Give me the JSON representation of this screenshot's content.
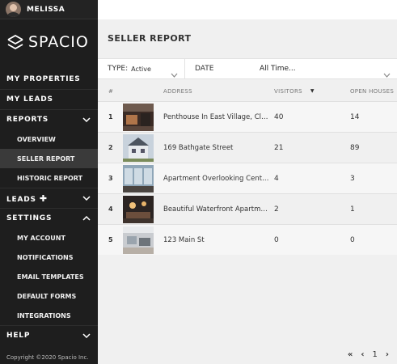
{
  "user": {
    "name": "MELISSA"
  },
  "brand": {
    "name": "SPACIO"
  },
  "nav": {
    "my_properties": "MY PROPERTIES",
    "my_leads": "MY LEADS",
    "reports": "REPORTS",
    "reports_items": [
      "OVERVIEW",
      "SELLER REPORT",
      "HISTORIC REPORT"
    ],
    "leads": "LEADS",
    "settings": "SETTINGS",
    "settings_items": [
      "MY ACCOUNT",
      "NOTIFICATIONS",
      "EMAIL TEMPLATES",
      "DEFAULT FORMS",
      "INTEGRATIONS"
    ],
    "help": "HELP",
    "copyright": "Copyright ©2020 Spacio Inc."
  },
  "page": {
    "title": "SELLER REPORT"
  },
  "filters": {
    "type_label": "TYPE:",
    "type_value": "Active",
    "date_label": "DATE",
    "date_value": "All Time..."
  },
  "table": {
    "headers": {
      "num": "#",
      "address": "ADDRESS",
      "visitors": "VISITORS",
      "open_houses": "OPEN HOUSES"
    },
    "rows": [
      {
        "num": "1",
        "address": "Penthouse In East Village, Clo...",
        "visitors": "40",
        "open_houses": "14"
      },
      {
        "num": "2",
        "address": "169 Bathgate Street",
        "visitors": "21",
        "open_houses": "89"
      },
      {
        "num": "3",
        "address": "Apartment Overlooking Centr...",
        "visitors": "4",
        "open_houses": "3"
      },
      {
        "num": "4",
        "address": "Beautiful Waterfront Apartme...",
        "visitors": "2",
        "open_houses": "1"
      },
      {
        "num": "5",
        "address": "123 Main St",
        "visitors": "0",
        "open_houses": "0"
      }
    ]
  },
  "pagination": {
    "first": "«",
    "prev": "‹",
    "page": "1",
    "next": "›"
  },
  "colors": {
    "sidebar": "#1e1e1e",
    "main_bg": "#f0f0f0",
    "active_item": "#3a3a3a"
  }
}
